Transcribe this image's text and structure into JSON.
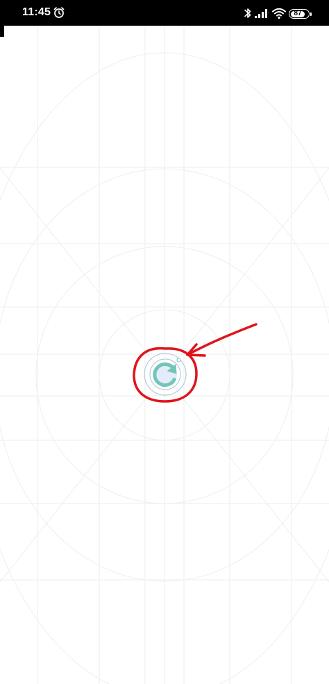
{
  "status_bar": {
    "time": "11:45",
    "battery_level": "87",
    "icons": [
      "alarm-icon",
      "bluetooth-icon",
      "signal-icon",
      "wifi-icon",
      "battery-icon"
    ]
  },
  "main": {
    "refresh_icon": "refresh-icon"
  },
  "colors": {
    "status_bar_bg": "#000000",
    "refresh_accent": "#72c6b6",
    "refresh_fill": "#e4ecfb",
    "annotation_red": "#e0141b",
    "grid_line": "#eeeeee"
  }
}
